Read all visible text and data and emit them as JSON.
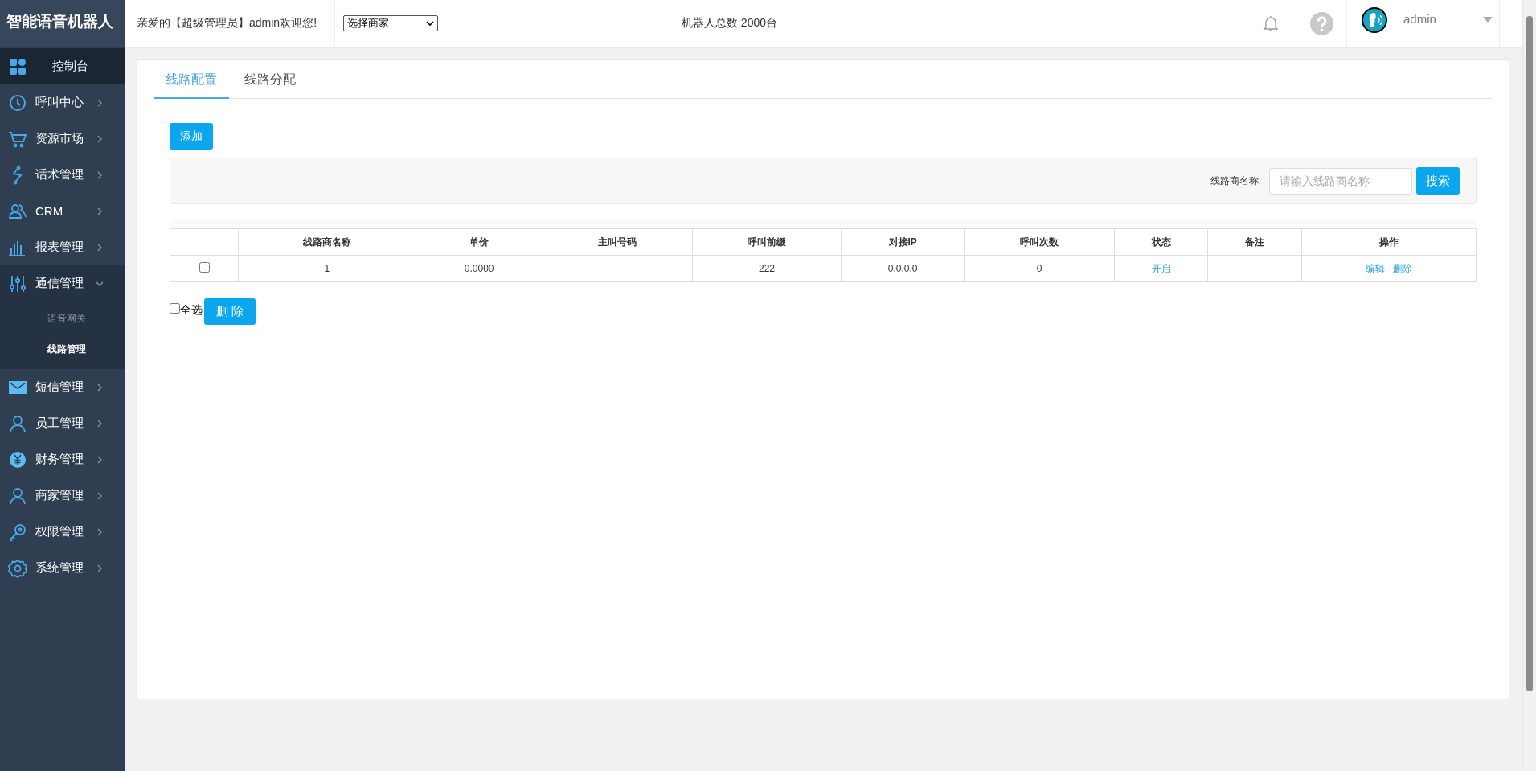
{
  "sidebar": {
    "logo": "智能语音机器人",
    "items": [
      {
        "kind": "link",
        "label": "控制台",
        "selected": true
      },
      {
        "kind": "menu",
        "label": "呼叫中心",
        "selected": false,
        "expanded": false
      },
      {
        "kind": "menu",
        "label": "资源市场",
        "selected": false,
        "expanded": false
      },
      {
        "kind": "menu",
        "label": "话术管理",
        "selected": false,
        "expanded": false
      },
      {
        "kind": "menu",
        "label": "CRM",
        "selected": false,
        "expanded": false
      },
      {
        "kind": "menu",
        "label": "报表管理",
        "selected": false,
        "expanded": false
      },
      {
        "kind": "menu",
        "label": "通信管理",
        "selected": false,
        "expanded": true,
        "children": [
          {
            "label": "语音网关",
            "selected": false
          },
          {
            "label": "线路管理",
            "selected": true
          }
        ]
      },
      {
        "kind": "menu",
        "label": "短信管理",
        "selected": false,
        "expanded": false
      },
      {
        "kind": "menu",
        "label": "员工管理",
        "selected": false,
        "expanded": false
      },
      {
        "kind": "menu",
        "label": "财务管理",
        "selected": false,
        "expanded": false
      },
      {
        "kind": "menu",
        "label": "商家管理",
        "selected": false,
        "expanded": false
      },
      {
        "kind": "menu",
        "label": "权限管理",
        "selected": false,
        "expanded": false
      },
      {
        "kind": "menu",
        "label": "系统管理",
        "selected": false,
        "expanded": false
      }
    ]
  },
  "header": {
    "welcome": "亲爱的【超级管理员】admin欢迎您!",
    "merchant_select": "选择商家",
    "robot_total": "机器人总数 2000台",
    "user": "admin"
  },
  "tabs": [
    {
      "label": "线路配置",
      "selected": true
    },
    {
      "label": "线路分配",
      "selected": false
    }
  ],
  "add_button": "添加",
  "search": {
    "label": "线路商名称:",
    "placeholder": "请输入线路商名称",
    "button": "搜索"
  },
  "table": {
    "columns": [
      "",
      "线路商名称",
      "单价",
      "主叫号码",
      "呼叫前缀",
      "对接IP",
      "呼叫次数",
      "状态",
      "备注",
      "操作"
    ],
    "rows": [
      {
        "checked": false,
        "name": "1",
        "price": "0.0000",
        "caller": "",
        "prefix": "222",
        "ip": "0.0.0.0",
        "calls": "0",
        "status": "开启",
        "note": "",
        "actions": [
          "编辑",
          "删除"
        ]
      }
    ]
  },
  "footer": {
    "select_all": {
      "label": "全选",
      "checked": false
    },
    "delete_button": "删 除"
  }
}
